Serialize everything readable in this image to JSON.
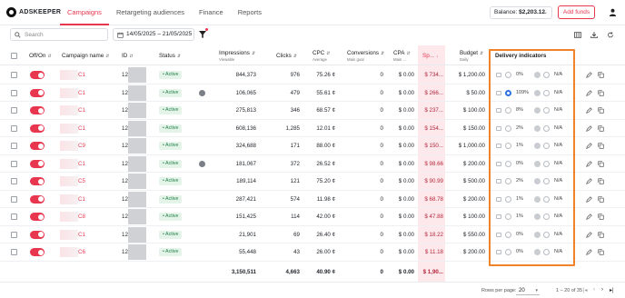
{
  "app": {
    "logo_text": "ADSKEEPER",
    "nav": [
      "Campaigns",
      "Retargeting audiences",
      "Finance",
      "Reports"
    ],
    "balance_label": "Balance:",
    "balance_value": "$2,203.12",
    "add_funds": "Add funds"
  },
  "toolbar": {
    "search_placeholder": "Search",
    "date_range": "14/05/2025 – 21/05/2025"
  },
  "table": {
    "headers": {
      "onoff": "Off/On",
      "name": "Campaign name",
      "id": "ID",
      "status": "Status",
      "impressions": "Impressions",
      "impressions_sub": "Viewable",
      "clicks": "Clicks",
      "cpc": "CPC",
      "cpc_sub": "Average",
      "conversions": "Conversions",
      "conversions_sub": "Main goal",
      "cpa": "CPA",
      "cpa_sub": "Main ...",
      "spent": "Sp...",
      "budget": "Budget",
      "budget_sub": "Daily",
      "delivery": "Delivery indicators"
    },
    "rows": [
      {
        "name": "C1",
        "id": "12(",
        "status": "Active",
        "paused_icon": false,
        "impressions": "844,373",
        "clicks": "976",
        "cpc": "75.26 ¢",
        "conversions": "0",
        "cpa": "$ 0.00",
        "spent": "$ 734...",
        "budget": "$ 1,200.00",
        "pct": "0%",
        "na": "N/A"
      },
      {
        "name": "C1",
        "id": "12(",
        "status": "Active",
        "paused_icon": true,
        "impressions": "106,065",
        "clicks": "479",
        "cpc": "55.61 ¢",
        "conversions": "0",
        "cpa": "$ 0.00",
        "spent": "$ 266...",
        "budget": "$ 50.00",
        "pct": "109%",
        "na": "N/A"
      },
      {
        "name": "C1",
        "id": "12(",
        "status": "Active",
        "paused_icon": false,
        "impressions": "275,813",
        "clicks": "346",
        "cpc": "68.57 ¢",
        "conversions": "0",
        "cpa": "$ 0.00",
        "spent": "$ 237...",
        "budget": "$ 100.00",
        "pct": "8%",
        "na": "N/A"
      },
      {
        "name": "C1",
        "id": "12(",
        "status": "Active",
        "paused_icon": false,
        "impressions": "608,136",
        "clicks": "1,285",
        "cpc": "12.01 ¢",
        "conversions": "0",
        "cpa": "$ 0.00",
        "spent": "$ 154...",
        "budget": "$ 150.00",
        "pct": "2%",
        "na": "N/A"
      },
      {
        "name": "C9",
        "id": "12(",
        "status": "Active",
        "paused_icon": false,
        "impressions": "324,688",
        "clicks": "171",
        "cpc": "88.00 ¢",
        "conversions": "0",
        "cpa": "$ 0.00",
        "spent": "$ 150...",
        "budget": "$ 1,000.00",
        "pct": "1%",
        "na": "N/A"
      },
      {
        "name": "C1",
        "id": "12(",
        "status": "Active",
        "paused_icon": true,
        "impressions": "181,067",
        "clicks": "372",
        "cpc": "26.52 ¢",
        "conversions": "0",
        "cpa": "$ 0.00",
        "spent": "$ 98.66",
        "budget": "$ 200.00",
        "pct": "0%",
        "na": "N/A"
      },
      {
        "name": "C5",
        "id": "12(",
        "status": "Active",
        "paused_icon": false,
        "impressions": "189,114",
        "clicks": "121",
        "cpc": "75.20 ¢",
        "conversions": "0",
        "cpa": "$ 0.00",
        "spent": "$ 90.99",
        "budget": "$ 500.00",
        "pct": "2%",
        "na": "N/A"
      },
      {
        "name": "C1",
        "id": "12(",
        "status": "Active",
        "paused_icon": false,
        "impressions": "287,421",
        "clicks": "574",
        "cpc": "11.98 ¢",
        "conversions": "0",
        "cpa": "$ 0.00",
        "spent": "$ 68.78",
        "budget": "$ 200.00",
        "pct": "1%",
        "na": "N/A"
      },
      {
        "name": "C8",
        "id": "12(",
        "status": "Active",
        "paused_icon": false,
        "impressions": "151,425",
        "clicks": "114",
        "cpc": "42.00 ¢",
        "conversions": "0",
        "cpa": "$ 0.00",
        "spent": "$ 47.88",
        "budget": "$ 100.00",
        "pct": "1%",
        "na": "N/A"
      },
      {
        "name": "C1",
        "id": "12(",
        "status": "Active",
        "paused_icon": false,
        "impressions": "21,901",
        "clicks": "69",
        "cpc": "26.40 ¢",
        "conversions": "0",
        "cpa": "$ 0.00",
        "spent": "$ 18.22",
        "budget": "$ 550.00",
        "pct": "0%",
        "na": "N/A"
      },
      {
        "name": "C6",
        "id": "12(",
        "status": "Active",
        "paused_icon": false,
        "impressions": "55,448",
        "clicks": "43",
        "cpc": "26.00 ¢",
        "conversions": "0",
        "cpa": "$ 0.00",
        "spent": "$ 11.18",
        "budget": "$ 200.00",
        "pct": "0%",
        "na": "N/A"
      }
    ],
    "totals": {
      "impressions": "3,150,511",
      "clicks": "4,663",
      "cpc": "40.90 ¢",
      "conversions": "0",
      "cpa": "$ 0.00",
      "spent": "$ 1,90..."
    }
  },
  "footer": {
    "rows_per_page_label": "Rows per page:",
    "rows_per_page": "20",
    "range": "1 – 20 of 35"
  },
  "colors": {
    "accent": "#e8364f",
    "highlight": "#f08328",
    "active_bg": "#e4f4e8"
  }
}
